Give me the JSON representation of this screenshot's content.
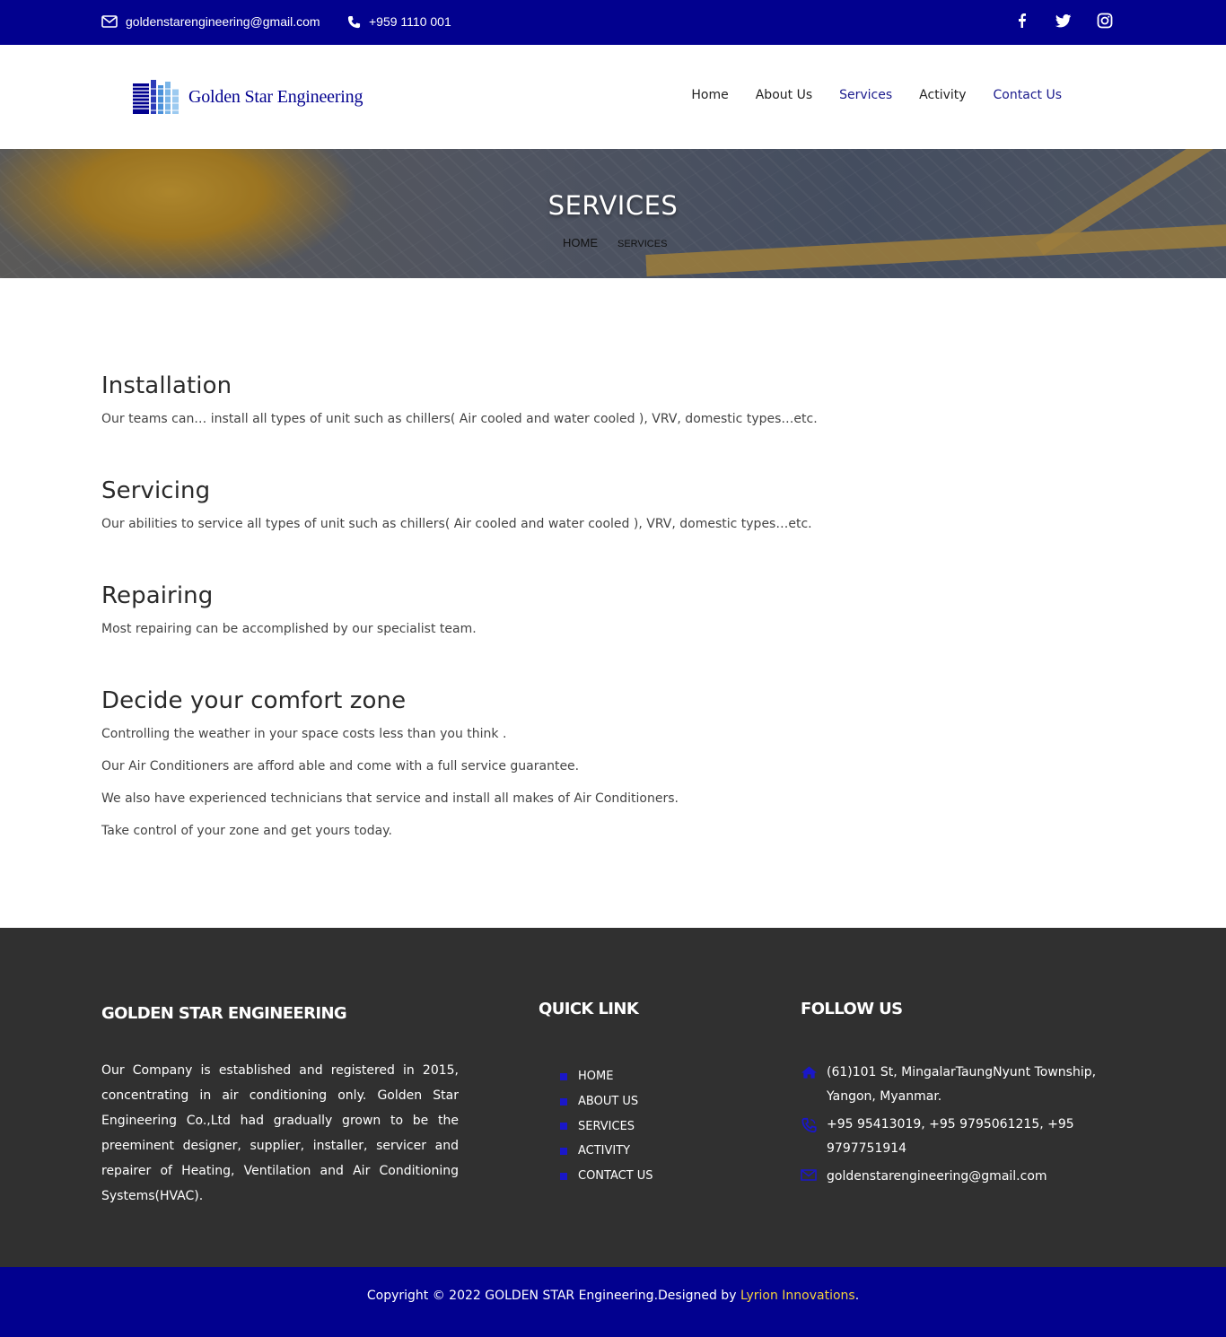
{
  "topbar": {
    "email": "goldenstarengineering@gmail.com",
    "phone": "+959 1110 001",
    "social_icons": [
      "facebook-icon",
      "twitter-icon",
      "instagram-icon"
    ]
  },
  "header": {
    "logo_text": "Golden Star Engineering",
    "nav": [
      "Home",
      "About Us",
      "Services",
      "Activity",
      "Contact Us"
    ],
    "active_nav": [
      "Services",
      "Contact Us"
    ]
  },
  "banner": {
    "title": "SERVICES",
    "breadcrumb": [
      "HOME",
      "SERVICES"
    ]
  },
  "sections": [
    {
      "heading": "Installation",
      "paragraphs": [
        "Our teams can… install all types of unit such as chillers( Air cooled and water cooled ), VRV, domestic types…etc."
      ]
    },
    {
      "heading": "Servicing",
      "paragraphs": [
        "Our abilities to service all types of unit such as chillers( Air cooled and water cooled ), VRV, domestic types…etc."
      ]
    },
    {
      "heading": "Repairing",
      "paragraphs": [
        "Most repairing can be accomplished by our specialist team."
      ]
    },
    {
      "heading": "Decide your comfort zone",
      "paragraphs": [
        "Controlling the weather in your space costs less than you think .",
        "Our Air Conditioners are afford able and come with a full service guarantee.",
        "We also have experienced technicians that service and install all makes of Air Conditioners.",
        "Take control of your zone and get yours today."
      ]
    }
  ],
  "footer": {
    "company_title": "GOLDEN STAR ENGINEERING",
    "about": "Our Company is established and registered in 2015, concentrating in air conditioning only. Golden Star Engineering Co.,Ltd had gradually grown to be the preeminent designer, supplier, installer, servicer and repairer of Heating, Ventilation and Air Conditioning Systems(HVAC).",
    "quick_link_title": "QUICK LINK",
    "quick_links": [
      "HOME",
      "ABOUT US",
      "SERVICES",
      "ACTIVITY",
      "CONTACT US"
    ],
    "follow_title": "FOLLOW US",
    "address": "(61)101 St, MingalarTaungNyunt Township, Yangon, Myanmar.",
    "phones": "+95 95413019, +95 9795061215, +95 9797751914",
    "email": "goldenstarengineering@gmail.com"
  },
  "copyright": {
    "text": "Copyright © 2022 GOLDEN STAR Engineering.Designed by",
    "brand": "Lyrion Innovations",
    "end": "."
  },
  "colors": {
    "primary": "#02018f",
    "footer_bg": "#303030",
    "brand_highlight": "#f4d13a",
    "bullet": "#1a17c9"
  }
}
